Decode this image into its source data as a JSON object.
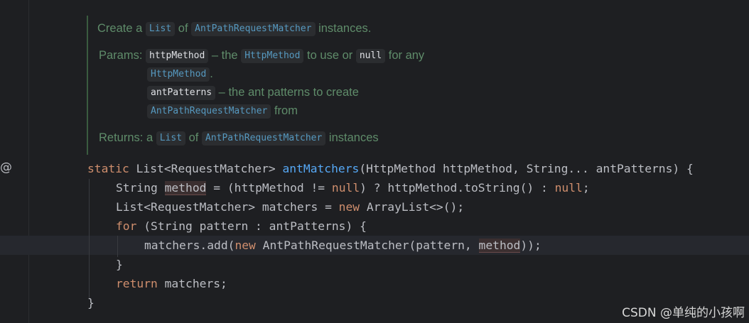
{
  "doc": {
    "line1": {
      "pre": "Create a ",
      "c1": "List",
      "mid": " of ",
      "c2": "AntPathRequestMatcher",
      "post": " instances."
    },
    "params": {
      "label": "Params: ",
      "p1": "httpMethod",
      "p1_dash": " – the ",
      "p1_c": "HttpMethod",
      "p1_mid": " to use or ",
      "p1_null": "null",
      "p1_post": " for any",
      "p1_c2": "HttpMethod",
      "p1_dot": ".",
      "p2": "antPatterns",
      "p2_text": " – the ant patterns to create",
      "p2_c": "AntPathRequestMatcher",
      "p2_post": " from"
    },
    "returns": {
      "pre": "Returns: a ",
      "c1": "List",
      "mid": " of ",
      "c2": "AntPathRequestMatcher",
      "post": " instances"
    }
  },
  "code": {
    "l1": {
      "kw": "static ",
      "t1": "List<RequestMatcher> ",
      "fn": "antMatchers",
      "rest": "(HttpMethod httpMethod, String... antPatterns) {"
    },
    "l2": {
      "a": "String ",
      "hl": "method",
      "b": " = (httpMethod != ",
      "k1": "null",
      "c": ") ? httpMethod.toString() : ",
      "k2": "null",
      "d": ";"
    },
    "l3": {
      "a": "List<RequestMatcher> matchers = ",
      "k": "new",
      "b": " ArrayList<>();"
    },
    "l4": {
      "k": "for",
      "b": " (String pattern : antPatterns) {"
    },
    "l5": {
      "a": "matchers.add(",
      "k": "new",
      "b": " AntPathRequestMatcher(pattern, ",
      "hl": "method",
      "c": "));"
    },
    "l6": "}",
    "l7": {
      "k": "return",
      "b": " matchers;"
    },
    "l8": "}"
  },
  "gutter_icon": "@",
  "watermark": "CSDN @单纯的小孩啊"
}
